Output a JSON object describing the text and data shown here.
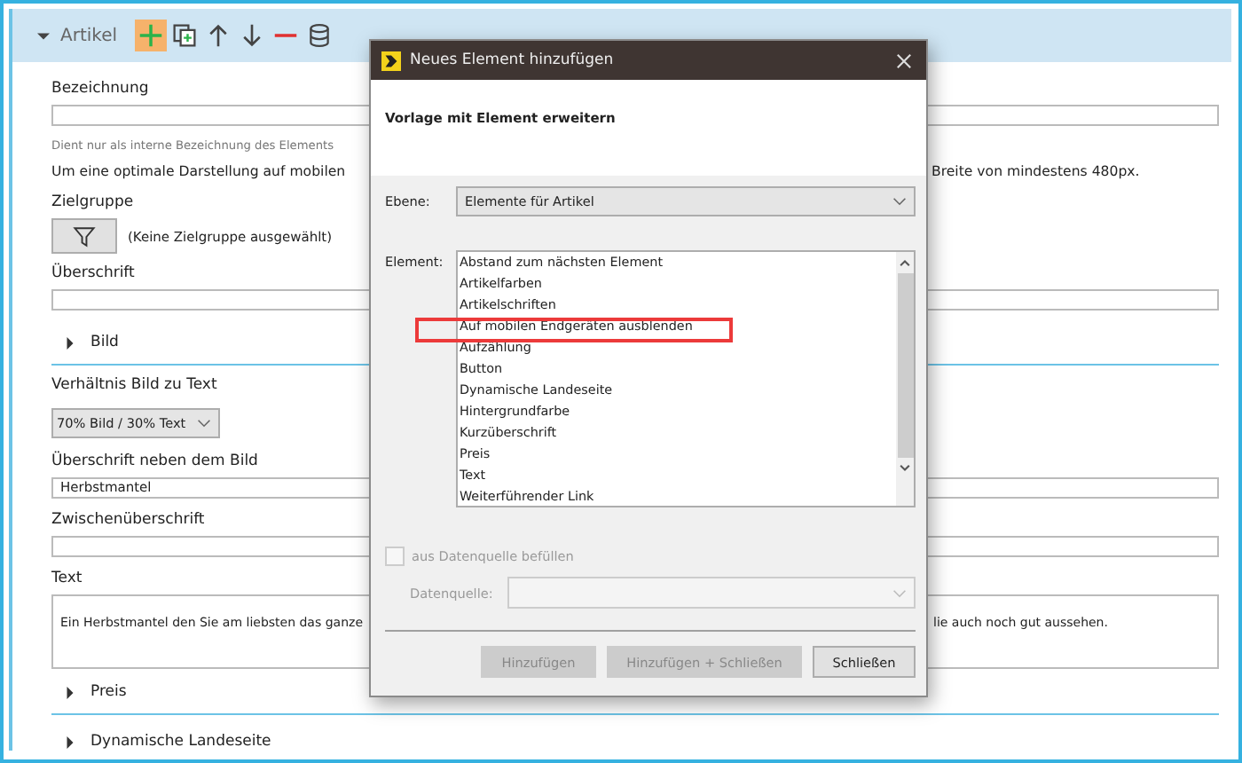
{
  "panel": {
    "title": "Artikel",
    "expanded": true,
    "toolbar": [
      {
        "kind": "add",
        "highlighted": true
      },
      {
        "kind": "copy",
        "highlighted": false
      },
      {
        "kind": "up",
        "highlighted": false
      },
      {
        "kind": "down",
        "highlighted": false
      },
      {
        "kind": "remove",
        "highlighted": false
      },
      {
        "kind": "database",
        "highlighted": false
      }
    ]
  },
  "rows": [
    {
      "kind": "label",
      "text": "Bezeichnung"
    },
    {
      "kind": "input",
      "value": ""
    },
    {
      "kind": "hint",
      "left": "Dient nur als interne Bezeichnung des Elements"
    },
    {
      "kind": "note",
      "left": "Um eine optimale Darstellung auf mobilen",
      "right": "Breite von mindestens 480px."
    },
    {
      "kind": "label",
      "text": "Zielgruppe"
    },
    {
      "kind": "target",
      "text": "(Keine Zielgruppe ausgewählt)"
    },
    {
      "kind": "label",
      "text": "Überschrift"
    },
    {
      "kind": "input",
      "value": ""
    },
    {
      "kind": "section",
      "text": "Bild",
      "expanded": false
    },
    {
      "kind": "label",
      "text": "Verhältnis Bild zu Text"
    },
    {
      "kind": "select",
      "value": "70% Bild / 30% Text"
    },
    {
      "kind": "label",
      "text": "Überschrift neben dem Bild"
    },
    {
      "kind": "input",
      "value": "Herbstmantel"
    },
    {
      "kind": "label",
      "text": "Zwischenüberschrift"
    },
    {
      "kind": "input",
      "value": ""
    },
    {
      "kind": "label",
      "text": "Text"
    },
    {
      "kind": "textarea",
      "left": "Ein Herbstmantel den Sie am liebsten das ganze",
      "right": "lie auch noch gut aussehen."
    },
    {
      "kind": "section",
      "text": "Preis",
      "expanded": false
    },
    {
      "kind": "section",
      "text": "Dynamische Landeseite",
      "expanded": false
    }
  ],
  "dialog": {
    "title": "Neues Element hinzufügen",
    "heading": "Vorlage mit Element erweitern",
    "level_label": "Ebene:",
    "level_value": "Elemente für Artikel",
    "element_label": "Element:",
    "elements": [
      {
        "text": "Abstand zum nächsten Element",
        "marked": false
      },
      {
        "text": "Artikelfarben",
        "marked": false
      },
      {
        "text": "Artikelschriften",
        "marked": false
      },
      {
        "text": "Auf mobilen Endgeräten ausblenden",
        "marked": true
      },
      {
        "text": "Aufzählung",
        "marked": false
      },
      {
        "text": "Button",
        "marked": false
      },
      {
        "text": "Dynamische Landeseite",
        "marked": false
      },
      {
        "text": "Hintergrundfarbe",
        "marked": false
      },
      {
        "text": "Kurzüberschrift",
        "marked": false
      },
      {
        "text": "Preis",
        "marked": false
      },
      {
        "text": "Text",
        "marked": false
      },
      {
        "text": "Weiterführender Link",
        "marked": false
      }
    ],
    "source_checkbox": {
      "label": "aus Datenquelle befüllen",
      "checked": false,
      "disabled": true
    },
    "source_label": "Datenquelle:",
    "buttons": [
      {
        "label": "Hinzufügen",
        "disabled": true
      },
      {
        "label": "Hinzufügen + Schließen",
        "disabled": true
      },
      {
        "label": "Schließen",
        "disabled": false
      }
    ]
  }
}
